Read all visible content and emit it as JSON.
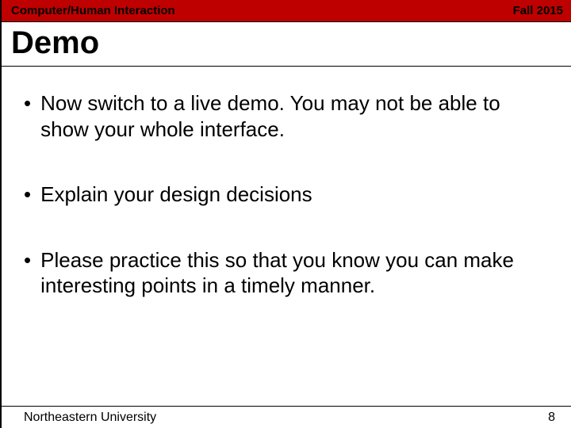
{
  "header": {
    "course": "Computer/Human Interaction",
    "term": "Fall 2015"
  },
  "title": "Demo",
  "bullets": [
    "Now switch to a live demo. You may not be able to show your whole interface.",
    "Explain your design decisions",
    "Please practice this so that you know you can make interesting points in a timely manner."
  ],
  "footer": {
    "org": "Northeastern University",
    "page": "8"
  }
}
